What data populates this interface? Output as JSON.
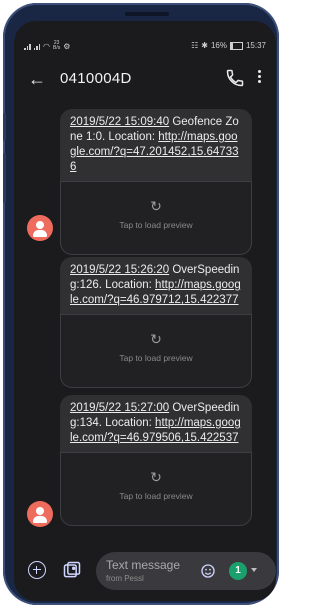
{
  "status_bar": {
    "signal_icon": "signal-icon",
    "net_speed_value": "23",
    "net_speed_unit": "B/s",
    "battery_percent": "16%",
    "time": "15:37"
  },
  "appbar": {
    "title": "0410004D",
    "back_icon": "back-arrow-icon",
    "call_icon": "phone-icon",
    "more_icon": "more-vertical-icon"
  },
  "messages": [
    {
      "timestamp": "2019/5/22 15:09:40",
      "text": "Geofence Zone 1:0. Location: ",
      "link": "http://maps.google.com/?q=47.201452,15.647336",
      "preview_label": "Tap to load preview",
      "show_avatar": true
    },
    {
      "timestamp": "2019/5/22 15:26:20",
      "text": "OverSpeeding:126. Location: ",
      "link": "http://maps.google.com/?q=46.979712,15.422377",
      "preview_label": "Tap to load preview",
      "show_avatar": false
    },
    {
      "timestamp": "2019/5/22 15:27:00",
      "text": "OverSpeeding:134. Location: ",
      "link": "http://maps.google.com/?q=46.979506,15.422537",
      "preview_label": "Tap to load preview",
      "show_avatar": true
    }
  ],
  "composer": {
    "placeholder": "Text message",
    "sub_label": "from Pessl",
    "sim_label": "1"
  },
  "colors": {
    "avatar": "#ee6c5e",
    "sim_badge": "#1aa06d",
    "bubble": "#303033",
    "background": "#1b1b1d"
  }
}
